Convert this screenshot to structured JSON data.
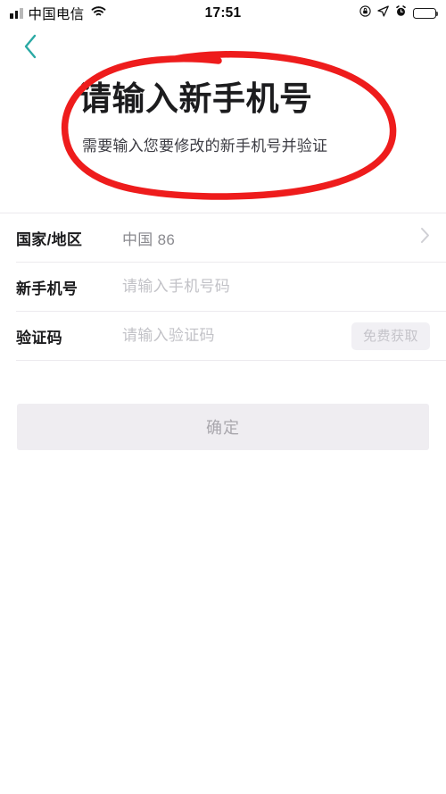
{
  "status_bar": {
    "carrier": "中国电信",
    "time": "17:51",
    "signal_icon": "signal-bars-icon",
    "wifi_icon": "wifi-icon",
    "rotation_lock_icon": "rotation-lock-icon",
    "location_icon": "location-arrow-icon",
    "alarm_icon": "alarm-clock-icon",
    "battery_icon": "battery-full-icon"
  },
  "nav": {
    "back_icon": "chevron-left-icon",
    "back_color": "#2aa9a4"
  },
  "header": {
    "title": "请输入新手机号",
    "subtitle": "需要输入您要修改的新手机号并验证"
  },
  "form": {
    "rows": [
      {
        "label": "国家/地区",
        "value": "中国 86",
        "accessory": "chevron-right-icon"
      },
      {
        "label": "新手机号",
        "placeholder": "请输入手机号码",
        "value": ""
      },
      {
        "label": "验证码",
        "placeholder": "请输入验证码",
        "value": "",
        "action_label": "免费获取"
      }
    ]
  },
  "submit": {
    "label": "确定"
  },
  "annotation": {
    "type": "hand-drawn-ellipse",
    "color": "#ee1c1c",
    "stroke_width": 7
  }
}
